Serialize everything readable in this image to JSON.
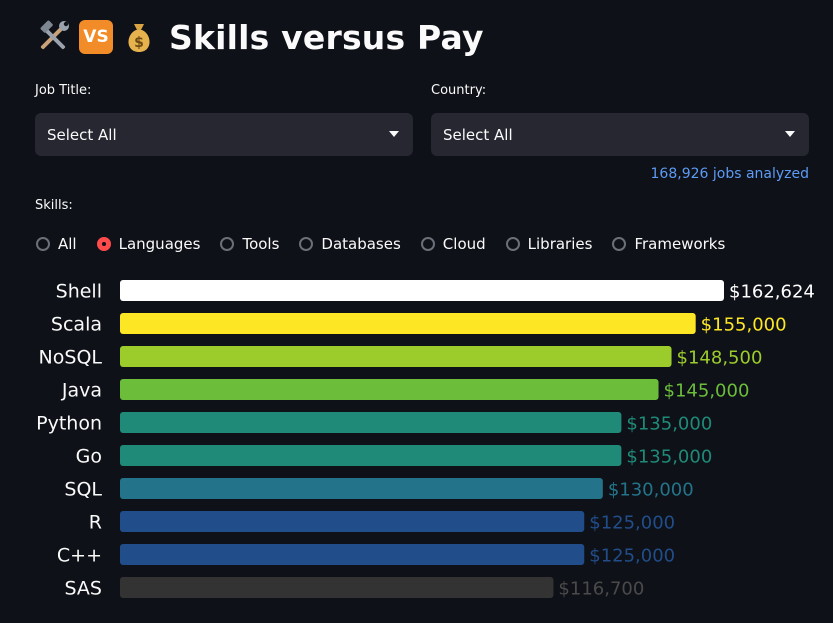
{
  "header": {
    "title": "Skills versus Pay",
    "vs_badge": "VS",
    "icons": [
      "hammer-and-wrench-icon",
      "vs-icon",
      "money-bag-icon"
    ]
  },
  "filters": {
    "job_title_label": "Job Title:",
    "job_title_value": "Select All",
    "country_label": "Country:",
    "country_value": "Select All"
  },
  "jobs_analyzed": "168,926 jobs analyzed",
  "skills": {
    "label": "Skills:",
    "options": [
      "All",
      "Languages",
      "Tools",
      "Databases",
      "Cloud",
      "Libraries",
      "Frameworks"
    ],
    "selected": "Languages"
  },
  "colors": {
    "background": "#0e1117",
    "accent": "#ff4b4b",
    "link": "#5d9bf5"
  },
  "chart_data": {
    "type": "bar",
    "orientation": "horizontal",
    "categories": [
      "Shell",
      "Scala",
      "NoSQL",
      "Java",
      "Python",
      "Go",
      "SQL",
      "R",
      "C++",
      "SAS"
    ],
    "values": [
      162624,
      155000,
      148500,
      145000,
      135000,
      135000,
      130000,
      125000,
      125000,
      116700
    ],
    "labels": [
      "$162,624",
      "$155,000",
      "$148,500",
      "$145,000",
      "$135,000",
      "$135,000",
      "$130,000",
      "$125,000",
      "$125,000",
      "$116,700"
    ],
    "colors": [
      "#ffffff",
      "#fde725",
      "#9ccc2c",
      "#6bbd3a",
      "#1f8a78",
      "#1f8a78",
      "#23748a",
      "#214d8a",
      "#214d8a",
      "#333333"
    ],
    "xlim": [
      0,
      162624
    ],
    "grid": false
  }
}
